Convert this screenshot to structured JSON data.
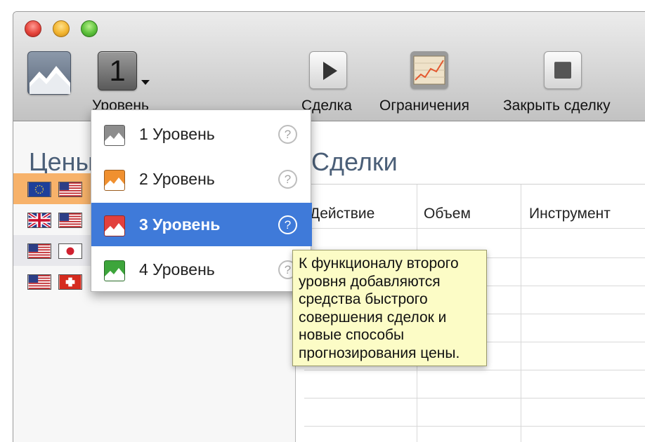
{
  "toolbar": {
    "level_value": "1",
    "level_label": "Уровень",
    "deal_label": "Сделка",
    "limits_label": "Ограничения",
    "close_deal_label": "Закрыть сделку",
    "logo_icon": "mountain-logo-icon",
    "deal_icon": "play-icon",
    "limits_icon": "chart-icon",
    "close_icon": "stop-icon"
  },
  "left_panel": {
    "title": "Цены",
    "rows": [
      {
        "flags": [
          "eu-flag-icon",
          "us-flag-icon"
        ],
        "selected": true
      },
      {
        "flags": [
          "uk-flag-icon",
          "us-flag-icon"
        ],
        "selected": false
      },
      {
        "flags": [
          "us-flag-icon",
          "jp-flag-icon"
        ],
        "selected": false
      },
      {
        "flags": [
          "us-flag-icon",
          "ch-flag-icon"
        ],
        "selected": false
      }
    ]
  },
  "deals_panel": {
    "title": "Сделки",
    "columns": [
      "Действие",
      "Объем",
      "Инструмент"
    ]
  },
  "level_menu": {
    "items": [
      {
        "label": "1 Уровень",
        "help": "?",
        "color": "#8d8d8d"
      },
      {
        "label": "2 Уровень",
        "help": "?",
        "color": "#f0902f"
      },
      {
        "label": "3 Уровень",
        "help": "?",
        "color": "#e2403d"
      },
      {
        "label": "4 Уровень",
        "help": "?",
        "color": "#3da53b"
      }
    ],
    "selected_index": 2
  },
  "tooltip": {
    "lines": [
      "К функционалу второго",
      "уровня добавляются",
      "средства быстрого",
      "совершения сделок и",
      "новые способы",
      "прогнозирования цены."
    ]
  },
  "colors": {
    "selection": "#3f7ad9",
    "tooltip_bg": "#fcfcc6",
    "title_text": "#4b5f78"
  }
}
